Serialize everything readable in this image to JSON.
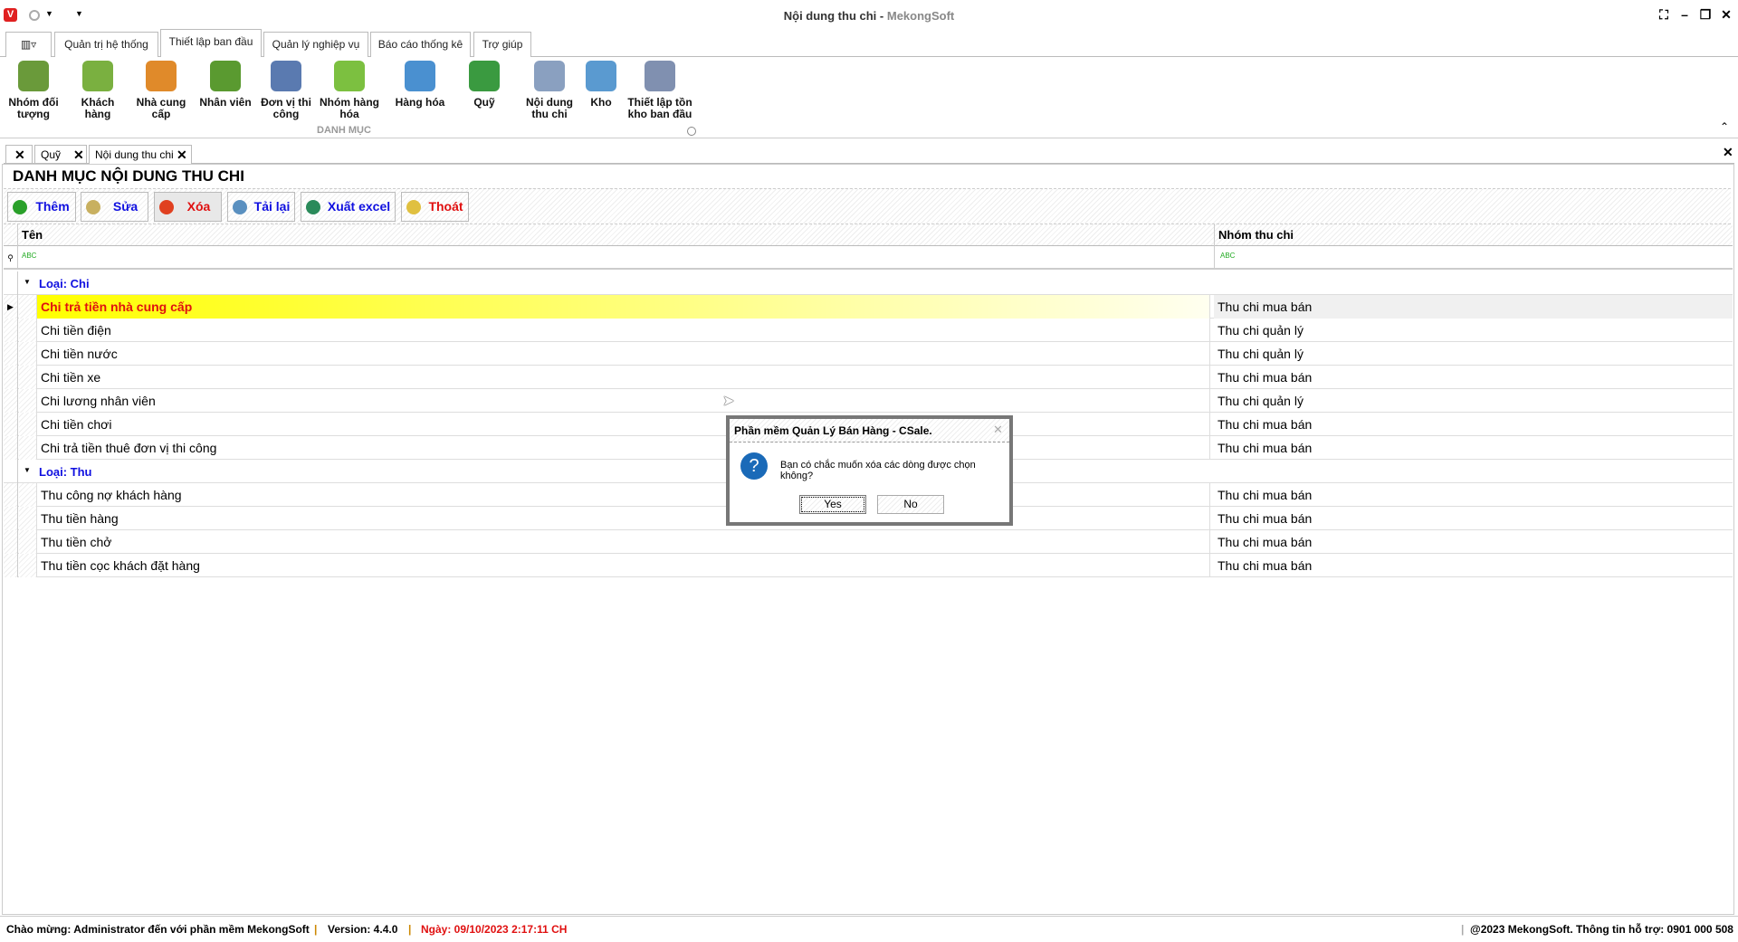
{
  "window": {
    "title": "Nội dung thu chi",
    "brand": "MekongSoft"
  },
  "ribbon_tabs": [
    "Quản trị hệ thống",
    "Thiết lập ban đầu",
    "Quản lý nghiệp vụ",
    "Báo cáo thống kê",
    "Trợ giúp"
  ],
  "ribbon_buttons": [
    {
      "label": "Nhóm đối tượng",
      "icon": "people-group-icon",
      "color": "#6a9a3a"
    },
    {
      "label": "Khách hàng",
      "icon": "customer-icon",
      "color": "#7ab040"
    },
    {
      "label": "Nhà cung cấp",
      "icon": "supplier-icon",
      "color": "#e08a2a"
    },
    {
      "label": "Nhân viên",
      "icon": "employee-icon",
      "color": "#5a9a30"
    },
    {
      "label": "Đơn vị thi công",
      "icon": "worker-icon",
      "color": "#5a7ab0"
    },
    {
      "label": "Nhóm hàng hóa",
      "icon": "product-group-icon",
      "color": "#7cc040"
    },
    {
      "label": "Hàng hóa",
      "icon": "star-icon",
      "color": "#4a90d0"
    },
    {
      "label": "Quỹ",
      "icon": "money-icon",
      "color": "#3a9a40"
    },
    {
      "label": "Nội dung thu chi",
      "icon": "document-add-icon",
      "color": "#8aa0c0"
    },
    {
      "label": "Kho",
      "icon": "house-icon",
      "color": "#5a9ad0"
    },
    {
      "label": "Thiết lập tồn kho ban đầu",
      "icon": "columns-icon",
      "color": "#8090b0"
    }
  ],
  "ribbon_group": "DANH MỤC",
  "doc_tabs": [
    "Quỹ",
    "Nội dung thu chi"
  ],
  "page_title": "DANH MỤC NỘI DUNG THU CHI",
  "toolbar": [
    {
      "label": "Thêm",
      "color": "#1010e0",
      "icon": "add-icon",
      "icolor": "#2aa02a"
    },
    {
      "label": "Sửa",
      "color": "#1010e0",
      "icon": "edit-icon",
      "icolor": "#c8b060"
    },
    {
      "label": "Xóa",
      "color": "#e01010",
      "icon": "delete-icon",
      "icolor": "#e04020"
    },
    {
      "label": "Tải lại",
      "color": "#1010e0",
      "icon": "refresh-icon",
      "icolor": "#5a90c0"
    },
    {
      "label": "Xuất excel",
      "color": "#1010e0",
      "icon": "excel-icon",
      "icolor": "#2a8a5a"
    },
    {
      "label": "Thoát",
      "color": "#e01010",
      "icon": "exit-icon",
      "icolor": "#e0c040"
    }
  ],
  "grid": {
    "columns": [
      "Tên",
      "Nhóm thu chi"
    ],
    "filter_icon": "ABC",
    "groups": [
      {
        "label": "Loại: Chi",
        "rows": [
          [
            "Chi trả tiền nhà cung cấp",
            "Thu chi mua bán"
          ],
          [
            "Chi tiền điện",
            "Thu chi quản lý"
          ],
          [
            "Chi tiền nước",
            "Thu chi quản lý"
          ],
          [
            "Chi tiền xe",
            "Thu chi mua bán"
          ],
          [
            "Chi lương nhân viên",
            "Thu chi quản lý"
          ],
          [
            "Chi tiền chơi",
            "Thu chi mua bán"
          ],
          [
            "Chi trả tiền thuê đơn vị thi công",
            "Thu chi mua bán"
          ]
        ]
      },
      {
        "label": "Loại: Thu",
        "rows": [
          [
            "Thu công nợ khách hàng",
            "Thu chi mua bán"
          ],
          [
            "Thu tiền hàng",
            "Thu chi mua bán"
          ],
          [
            "Thu tiền chở",
            "Thu chi mua bán"
          ],
          [
            "Thu tiền cọc khách đặt hàng",
            "Thu chi mua bán"
          ]
        ]
      }
    ]
  },
  "dialog": {
    "title": "Phần mềm Quản Lý Bán Hàng - CSale.",
    "message": "Bạn có chắc muốn xóa các dòng được chọn không?",
    "yes": "Yes",
    "no": "No"
  },
  "status": {
    "welcome": "Chào mừng: Administrator đến với phần mềm MekongSoft",
    "version": "Version: 4.4.0",
    "date": "Ngày: 09/10/2023 2:17:11 CH",
    "support": "@2023 MekongSoft. Thông tin hỗ trợ: 0901 000 508"
  }
}
